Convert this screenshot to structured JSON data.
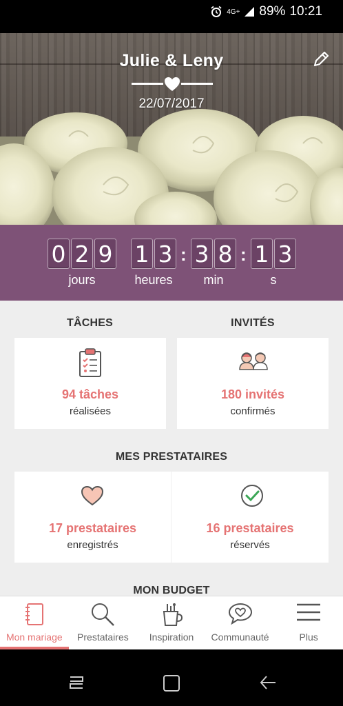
{
  "status_bar": {
    "network": "4G+",
    "battery": "89%",
    "time": "10:21"
  },
  "header": {
    "couple_names": "Julie & Leny",
    "wedding_date": "22/07/2017",
    "edit_icon": "pencil-icon"
  },
  "countdown": {
    "days_digits": [
      "0",
      "2",
      "9"
    ],
    "hours_digits": [
      "1",
      "3"
    ],
    "minutes_digits": [
      "3",
      "8"
    ],
    "seconds_digits": [
      "1",
      "3"
    ],
    "labels": {
      "days": "jours",
      "hours": "heures",
      "minutes": "min",
      "seconds": "s"
    },
    "separator": ":"
  },
  "tasks": {
    "title": "TÂCHES",
    "count_text": "94 tâches",
    "status_text": "réalisées",
    "icon": "clipboard-icon"
  },
  "guests": {
    "title": "INVITÉS",
    "count_text": "180 invités",
    "status_text": "confirmés",
    "icon": "guests-icon"
  },
  "vendors": {
    "title": "MES PRESTATAIRES",
    "saved": {
      "count_text": "17 prestataires",
      "status_text": "enregistrés",
      "icon": "heart-icon"
    },
    "booked": {
      "count_text": "16 prestataires",
      "status_text": "réservés",
      "icon": "check-circle-icon"
    }
  },
  "budget": {
    "title": "MON BUDGET"
  },
  "bottom_nav": [
    {
      "label": "Mon mariage",
      "icon": "notebook-icon",
      "active": true
    },
    {
      "label": "Prestataires",
      "icon": "search-icon",
      "active": false
    },
    {
      "label": "Inspiration",
      "icon": "inspiration-icon",
      "active": false
    },
    {
      "label": "Communauté",
      "icon": "chat-heart-icon",
      "active": false
    },
    {
      "label": "Plus",
      "icon": "menu-icon",
      "active": false
    }
  ],
  "colors": {
    "accent": "#e57373",
    "countdown_bg": "#7e5277",
    "content_bg": "#eeeeee"
  }
}
